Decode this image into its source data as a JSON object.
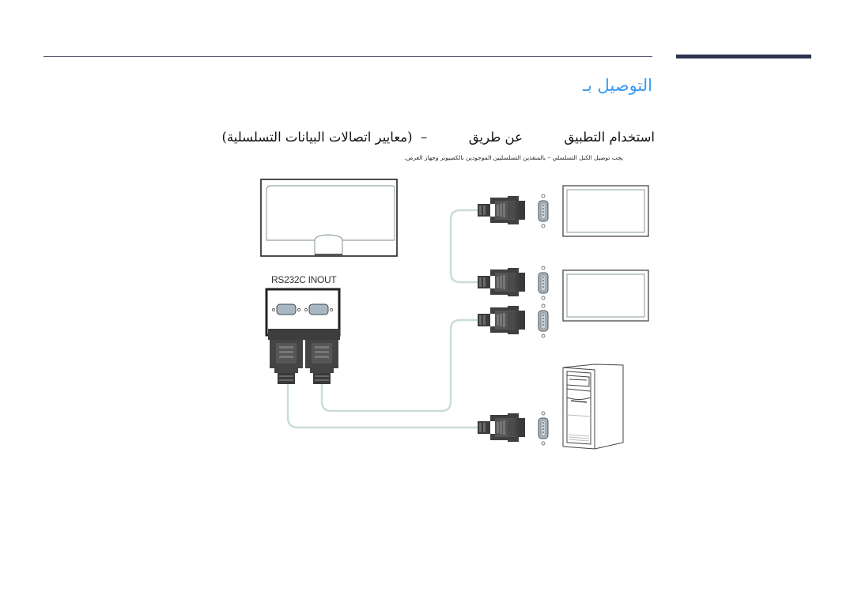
{
  "header": {
    "section_title": "التوصيل بـ"
  },
  "content": {
    "sub_heading": "استخدام التطبيق          عن طريق          –  (معايير اتصالات البيانات التسلسلية)",
    "note": "يجب توصيل الكبل التسلسلي – بالمنفذين التسلسليين الموجودين بالكمبيوتر وجهاز العرض."
  },
  "diagram": {
    "port_label": "RS232C INOUT",
    "devices": [
      {
        "name": "display-rear-panel",
        "icon": "display-back-icon"
      },
      {
        "name": "display-1",
        "icon": "monitor-icon"
      },
      {
        "name": "display-2",
        "icon": "monitor-icon"
      },
      {
        "name": "computer",
        "icon": "pc-tower-icon"
      }
    ],
    "colors": {
      "accent": "#3b9cf5",
      "cable": "#c9dcd8",
      "connector": "#4a4a4a",
      "port": "#a9b7c2"
    }
  }
}
